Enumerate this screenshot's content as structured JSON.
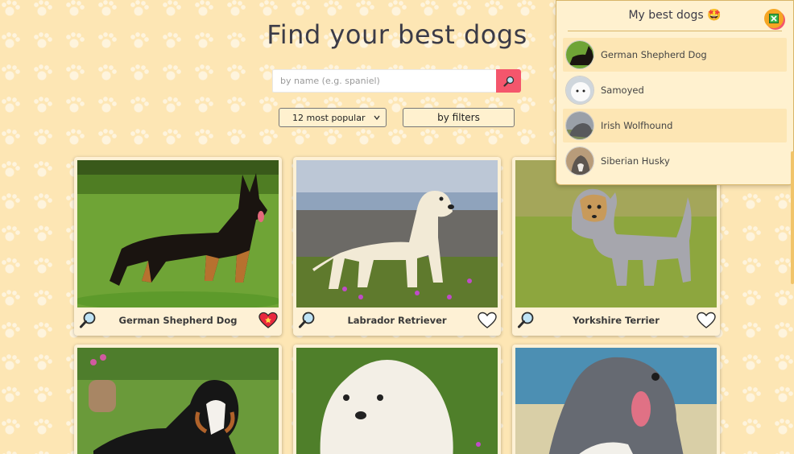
{
  "page": {
    "title": "Find your best dogs"
  },
  "search": {
    "placeholder": "by name (e.g. spaniel)"
  },
  "controls": {
    "sort_selected": "12 most popular",
    "filters_label": "by filters"
  },
  "cards": [
    {
      "name": "German Shepherd Dog",
      "favorited": true
    },
    {
      "name": "Labrador Retriever",
      "favorited": false
    },
    {
      "name": "Yorkshire Terrier",
      "favorited": false
    }
  ],
  "favorites": {
    "title": "My best dogs 🤩",
    "items": [
      {
        "label": "German Shepherd Dog"
      },
      {
        "label": "Samoyed"
      },
      {
        "label": "Irish Wolfhound"
      },
      {
        "label": "Siberian Husky"
      }
    ]
  },
  "colors": {
    "background": "#fde6b4",
    "accent": "#f4566c",
    "panel": "#fff1cf",
    "close_button": "#f5a623"
  }
}
